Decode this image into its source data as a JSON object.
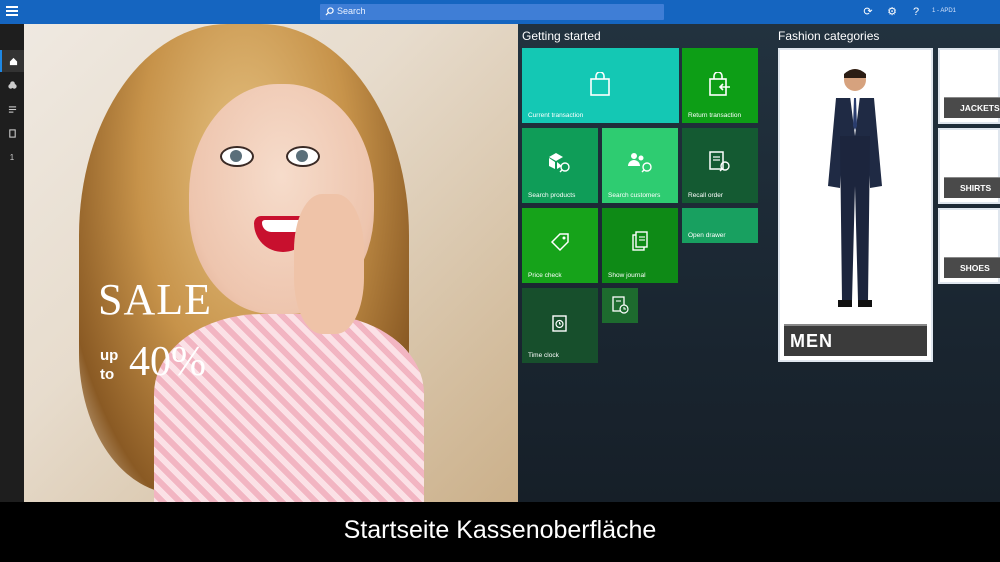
{
  "topbar": {
    "search_placeholder": "Search",
    "register_label": "1 - APD1",
    "icons": [
      "menu-icon",
      "search-icon",
      "refresh-icon",
      "settings-icon",
      "help-icon"
    ],
    "color": "#1565c0"
  },
  "sidebar": {
    "items": [
      {
        "icon": "home-icon"
      },
      {
        "icon": "products-icon"
      },
      {
        "icon": "list-icon"
      },
      {
        "icon": "transaction-icon"
      },
      {
        "label": "1"
      }
    ]
  },
  "hero": {
    "sale": "SALE",
    "up": "up",
    "to": "to",
    "percent": "40%"
  },
  "getting_started": {
    "title": "Getting started",
    "tiles": [
      {
        "label": "Current transaction",
        "color": "#14c8b4"
      },
      {
        "label": "Return transaction",
        "color": "#0d9e16"
      },
      {
        "label": "Search products",
        "color": "#0f9d58"
      },
      {
        "label": "Search customers",
        "color": "#2ecc71"
      },
      {
        "label": "Recall order",
        "color": "#145a32"
      },
      {
        "label": "Price check",
        "color": "#16a31a"
      },
      {
        "label": "Show journal",
        "color": "#0e8a16"
      },
      {
        "label": "Open drawer",
        "color": "#18a060"
      },
      {
        "label": "Time clock",
        "color": "#174f2c"
      },
      {
        "label": "",
        "color": "#1d6b2e"
      }
    ]
  },
  "fashion": {
    "title": "Fashion categories",
    "main_category": "MEN",
    "categories": [
      "JACKETS",
      "SHIRTS",
      "SHOES"
    ]
  },
  "caption": "Startseite Kassenoberfläche"
}
